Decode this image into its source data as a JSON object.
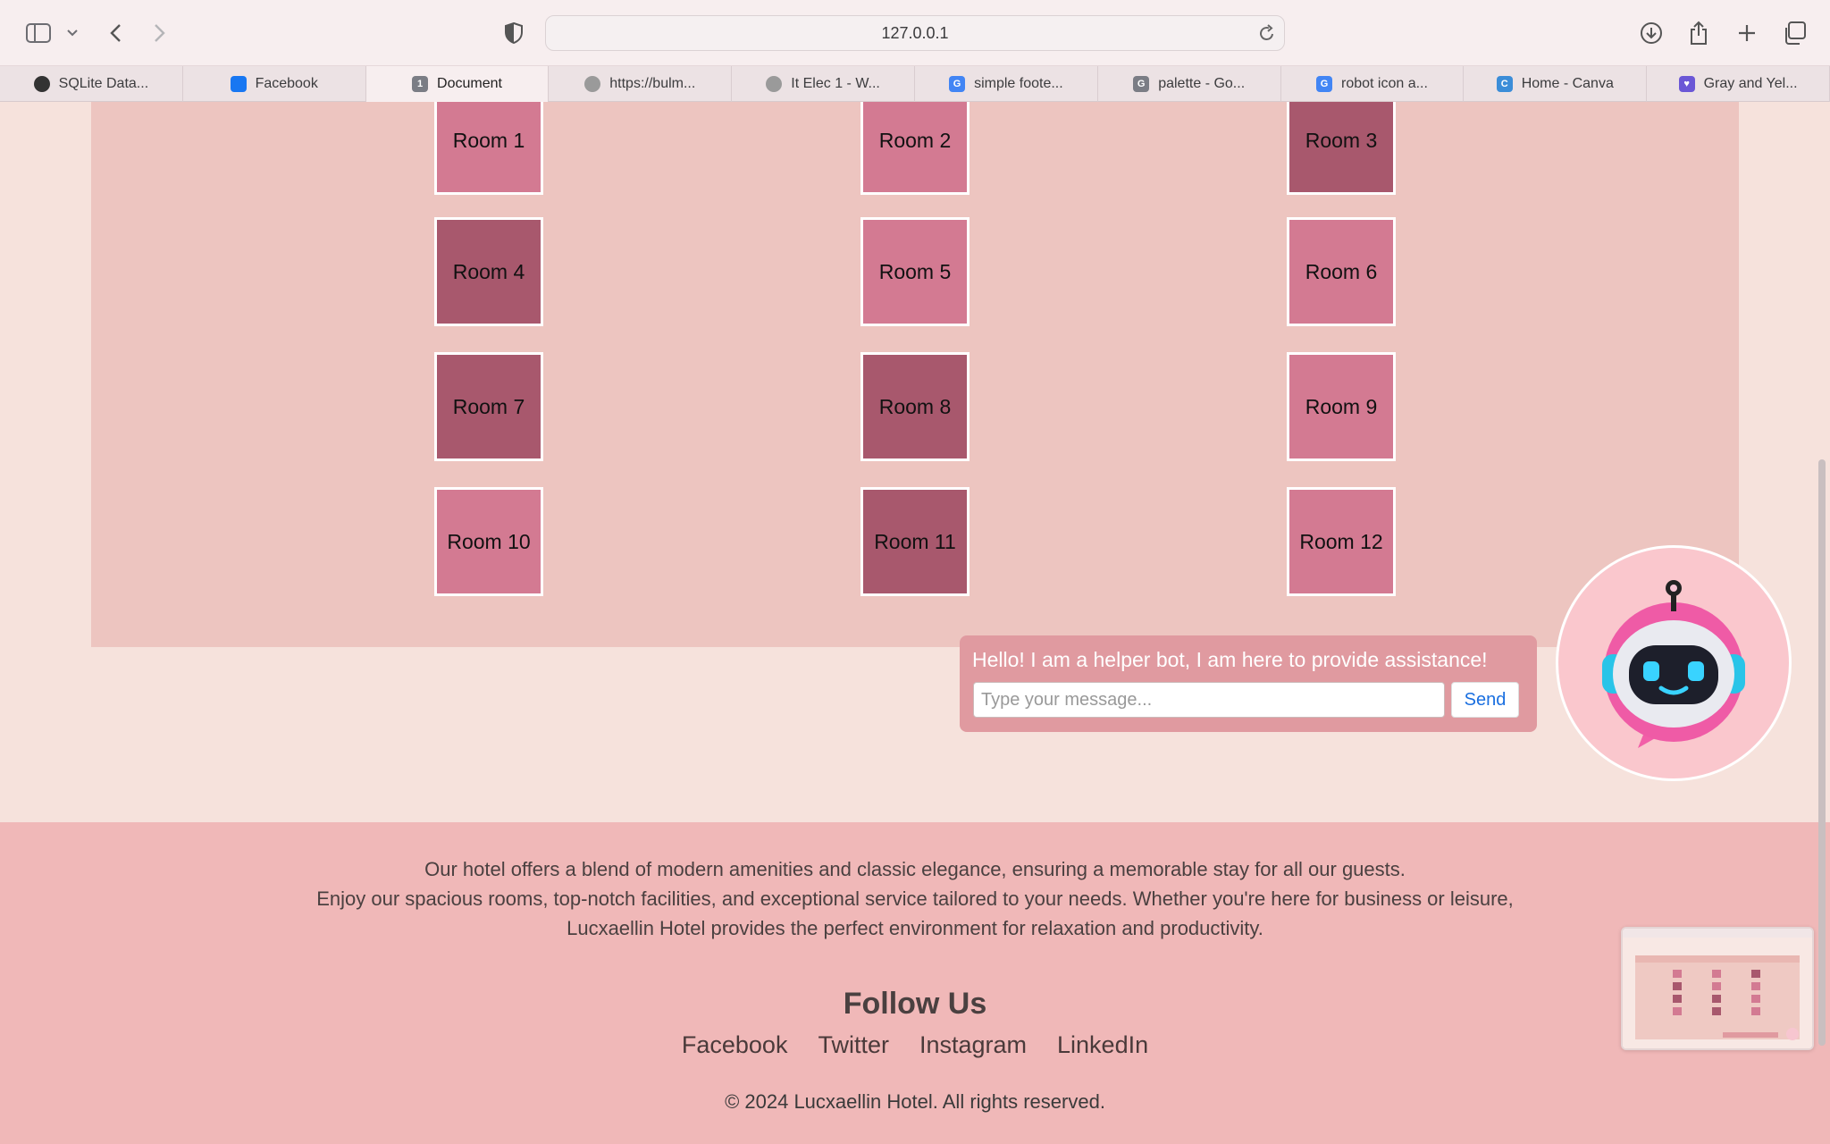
{
  "browser": {
    "url": "127.0.0.1",
    "tabs": [
      {
        "label": "SQLite Data...",
        "icon": "openai-icon",
        "color": "#333333"
      },
      {
        "label": "Facebook",
        "icon": "facebook-icon",
        "color": "#1877f2"
      },
      {
        "label": "Document",
        "icon": "document-icon",
        "color": "#7b7d85",
        "glyph": "1",
        "active": true
      },
      {
        "label": "https://bulm...",
        "icon": "globe-icon",
        "color": "#9a9a9a"
      },
      {
        "label": "It Elec 1 - W...",
        "icon": "globe-icon",
        "color": "#9a9a9a"
      },
      {
        "label": "simple foote...",
        "icon": "google-icon",
        "color": "#4285f4",
        "glyph": "G"
      },
      {
        "label": "palette - Go...",
        "icon": "document-icon",
        "color": "#7b7d85",
        "glyph": "G"
      },
      {
        "label": "robot icon a...",
        "icon": "google-icon",
        "color": "#4285f4",
        "glyph": "G"
      },
      {
        "label": "Home - Canva",
        "icon": "canva-icon",
        "color": "#3b8dd8",
        "glyph": "C"
      },
      {
        "label": "Gray and Yel...",
        "icon": "heart-icon",
        "color": "#6b57d6",
        "glyph": "♥"
      }
    ]
  },
  "rooms": [
    {
      "label": "Room 1",
      "tone": "light"
    },
    {
      "label": "Room 2",
      "tone": "light"
    },
    {
      "label": "Room 3",
      "tone": "dark"
    },
    {
      "label": "Room 4",
      "tone": "dark"
    },
    {
      "label": "Room 5",
      "tone": "light"
    },
    {
      "label": "Room 6",
      "tone": "light"
    },
    {
      "label": "Room 7",
      "tone": "dark"
    },
    {
      "label": "Room 8",
      "tone": "dark"
    },
    {
      "label": "Room 9",
      "tone": "light"
    },
    {
      "label": "Room 10",
      "tone": "light"
    },
    {
      "label": "Room 11",
      "tone": "dark"
    },
    {
      "label": "Room 12",
      "tone": "light"
    }
  ],
  "chat": {
    "message": "Hello! I am a helper bot, I am here to provide assistance!",
    "placeholder": "Type your message...",
    "send_label": "Send"
  },
  "footer": {
    "about_lines": [
      "Our hotel offers a blend of modern amenities and classic elegance, ensuring a memorable stay for all our guests.",
      "Enjoy our spacious rooms, top-notch facilities, and exceptional service tailored to your needs. Whether you're here for business or leisure,",
      "Lucxaellin Hotel provides the perfect environment for relaxation and productivity."
    ],
    "follow_title": "Follow Us",
    "social_links": [
      "Facebook",
      "Twitter",
      "Instagram",
      "LinkedIn"
    ],
    "copyright": "© 2024 Lucxaellin Hotel. All rights reserved."
  },
  "colors": {
    "room_light": "#d37a92",
    "room_dark": "#a8586d",
    "footer_bg": "#f0b8b8",
    "panel_bg": "#edc5c0",
    "chat_bg": "#e09aa0",
    "bot_bg": "#fac7cd"
  }
}
